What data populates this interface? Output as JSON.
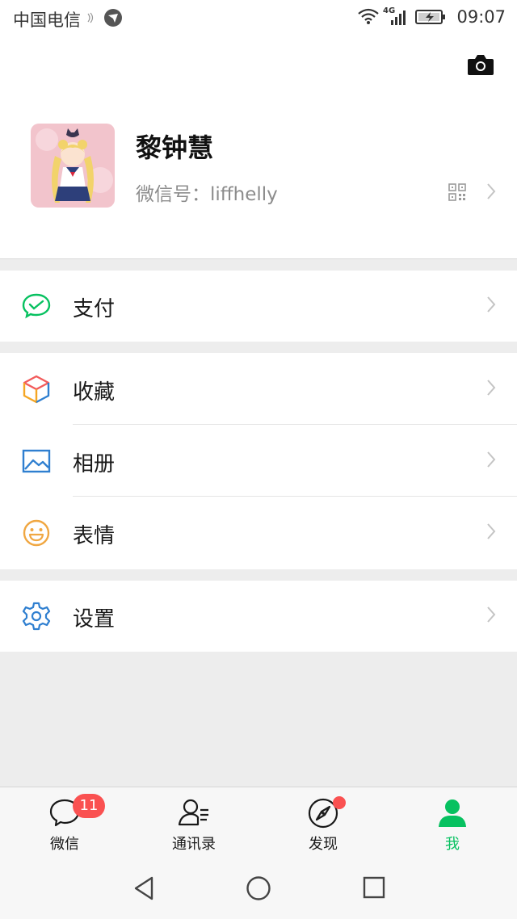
{
  "status_bar": {
    "carrier": "中国电信",
    "network": "4G",
    "time": "09:07"
  },
  "profile": {
    "name": "黎钟慧",
    "wechat_id_label": "微信号：",
    "wechat_id": "liffhelly"
  },
  "menu": {
    "pay": {
      "label": "支付",
      "icon": "wechat-pay-icon",
      "color": "#07c160"
    },
    "favorites": {
      "label": "收藏",
      "icon": "cube-icon"
    },
    "album": {
      "label": "相册",
      "icon": "picture-icon",
      "color": "#2f7fd0"
    },
    "stickers": {
      "label": "表情",
      "icon": "smiley-icon",
      "color": "#f0a742"
    },
    "settings": {
      "label": "设置",
      "icon": "gear-icon",
      "color": "#2f7fd0"
    }
  },
  "tabs": [
    {
      "label": "微信",
      "icon": "chat-icon",
      "badge": "11"
    },
    {
      "label": "通讯录",
      "icon": "contacts-icon"
    },
    {
      "label": "发现",
      "icon": "compass-icon",
      "dot": true
    },
    {
      "label": "我",
      "icon": "person-icon",
      "active": true
    }
  ],
  "colors": {
    "accent": "#07c160",
    "badge": "#fa5151",
    "background": "#ededed"
  }
}
